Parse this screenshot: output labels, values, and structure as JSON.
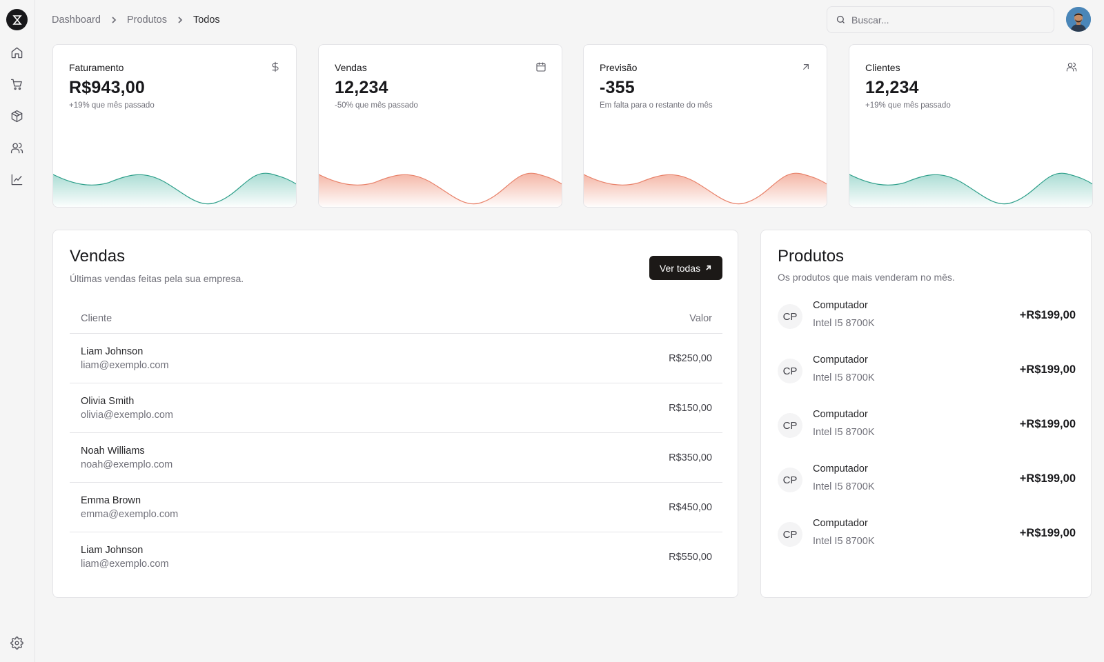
{
  "breadcrumb": [
    "Dashboard",
    "Produtos",
    "Todos"
  ],
  "search": {
    "placeholder": "Buscar..."
  },
  "sidebar": {
    "items": [
      {
        "name": "home-icon"
      },
      {
        "name": "cart-icon"
      },
      {
        "name": "package-icon"
      },
      {
        "name": "users-icon"
      },
      {
        "name": "line-chart-icon"
      }
    ],
    "footer": {
      "name": "gear-icon"
    }
  },
  "stats": [
    {
      "title": "Faturamento",
      "value": "R$943,00",
      "sub": "+19% que mês passado",
      "icon": "dollar-icon",
      "color": "#2e9f8a"
    },
    {
      "title": "Vendas",
      "value": "12,234",
      "sub": "-50% que mês passado",
      "icon": "calendar-icon",
      "color": "#e8826a"
    },
    {
      "title": "Previsão",
      "value": "-355",
      "sub": "Em falta para o restante do mês",
      "icon": "arrow-up-right-icon",
      "color": "#e8826a"
    },
    {
      "title": "Clientes",
      "value": "12,234",
      "sub": "+19% que mês passado",
      "icon": "users-icon",
      "color": "#2e9f8a"
    }
  ],
  "sales": {
    "title": "Vendas",
    "description": "Últimas vendas feitas pela sua empresa.",
    "button": "Ver todas",
    "columns": [
      "Cliente",
      "Valor"
    ],
    "rows": [
      {
        "name": "Liam Johnson",
        "email": "liam@exemplo.com",
        "amount": "R$250,00"
      },
      {
        "name": "Olivia Smith",
        "email": "olivia@exemplo.com",
        "amount": "R$150,00"
      },
      {
        "name": "Noah Williams",
        "email": "noah@exemplo.com",
        "amount": "R$350,00"
      },
      {
        "name": "Emma Brown",
        "email": "emma@exemplo.com",
        "amount": "R$450,00"
      },
      {
        "name": "Liam Johnson",
        "email": "liam@exemplo.com",
        "amount": "R$550,00"
      }
    ]
  },
  "products": {
    "title": "Produtos",
    "description": "Os produtos que mais venderam no mês.",
    "items": [
      {
        "initials": "CP",
        "name": "Computador",
        "detail": "Intel I5 8700K",
        "amount": "+R$199,00"
      },
      {
        "initials": "CP",
        "name": "Computador",
        "detail": "Intel I5 8700K",
        "amount": "+R$199,00"
      },
      {
        "initials": "CP",
        "name": "Computador",
        "detail": "Intel I5 8700K",
        "amount": "+R$199,00"
      },
      {
        "initials": "CP",
        "name": "Computador",
        "detail": "Intel I5 8700K",
        "amount": "+R$199,00"
      },
      {
        "initials": "CP",
        "name": "Computador",
        "detail": "Intel I5 8700K",
        "amount": "+R$199,00"
      }
    ]
  }
}
